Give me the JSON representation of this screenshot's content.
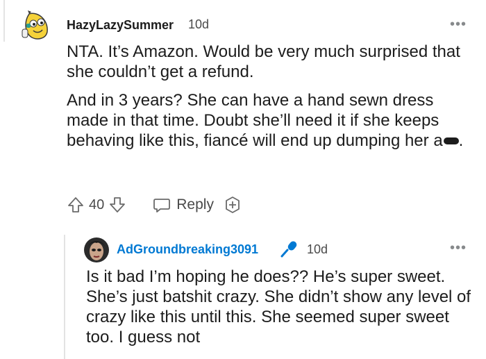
{
  "comment": {
    "username": "HazyLazySummer",
    "time": "10d",
    "paragraphs": [
      "NTA. It’s Amazon. Would be very much surprised that she couldn’t get a refund.",
      "And in 3 years? She can have a hand sewn dress made in that time. Doubt she’ll need it if she keeps behaving like this, fiancé will end up dumping her a"
    ],
    "paragraph_end": ".",
    "votes": "40",
    "reply_label": "Reply",
    "more": "•••"
  },
  "reply": {
    "username": "AdGroundbreaking3091",
    "time": "10d",
    "text": "Is it bad I’m hoping he does?? He’s super sweet. She’s just batshit crazy. She didn’t show any level of crazy like this until this. She seemed super sweet too. I guess not",
    "more": "•••"
  },
  "colors": {
    "username_link": "#0079d3",
    "icon_gray": "#6a6a6a",
    "avatar_yellow": "#f5d23a"
  },
  "icons": {
    "avatar": "banana-avatar-icon",
    "upvote": "arrow-up-icon",
    "downvote": "arrow-down-icon",
    "reply": "speech-bubble-icon",
    "award": "plus-award-icon",
    "mic": "microphone-icon"
  }
}
